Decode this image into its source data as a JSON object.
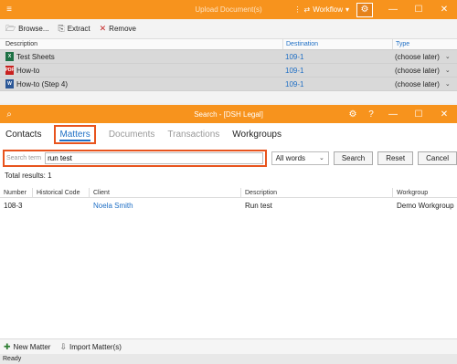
{
  "upload_window": {
    "title": "Upload Document(s)",
    "workflow_label": "Workflow",
    "toolbar": {
      "browse": "Browse...",
      "extract": "Extract",
      "remove": "Remove"
    },
    "columns": {
      "description": "Description",
      "destination": "Destination",
      "type": "Type"
    },
    "rows": [
      {
        "description": "Test Sheets",
        "destination": "109-1",
        "type": "(choose later)",
        "icon": "excel-file-icon"
      },
      {
        "description": "How-to",
        "destination": "109-1",
        "type": "(choose later)",
        "icon": "pdf-file-icon"
      },
      {
        "description": "How-to (Step 4)",
        "destination": "109-1",
        "type": "(choose later)",
        "icon": "word-file-icon"
      }
    ]
  },
  "search_window": {
    "title": "Search - [DSH Legal]",
    "tabs": [
      "Contacts",
      "Matters",
      "Documents",
      "Transactions",
      "Workgroups"
    ],
    "active_tab": "Matters",
    "search_term_label": "Search term",
    "search_term_value": "run test",
    "match_mode": "All words",
    "buttons": {
      "search": "Search",
      "reset": "Reset",
      "cancel": "Cancel"
    },
    "total_results": "Total results: 1",
    "columns": {
      "number": "Number",
      "historical_code": "Historical Code",
      "client": "Client",
      "description": "Description",
      "workgroup": "Workgroup"
    },
    "results": [
      {
        "number": "108-3",
        "historical_code": "",
        "client": "Noela Smith",
        "description": "Run test",
        "workgroup": "Demo Workgroup"
      }
    ]
  },
  "bottom": {
    "new_matter": "New Matter",
    "import_matters": "Import Matter(s)"
  },
  "status": "Ready",
  "colors": {
    "accent": "#f7931d",
    "highlight": "#e8541e",
    "link": "#1f6fc5"
  }
}
